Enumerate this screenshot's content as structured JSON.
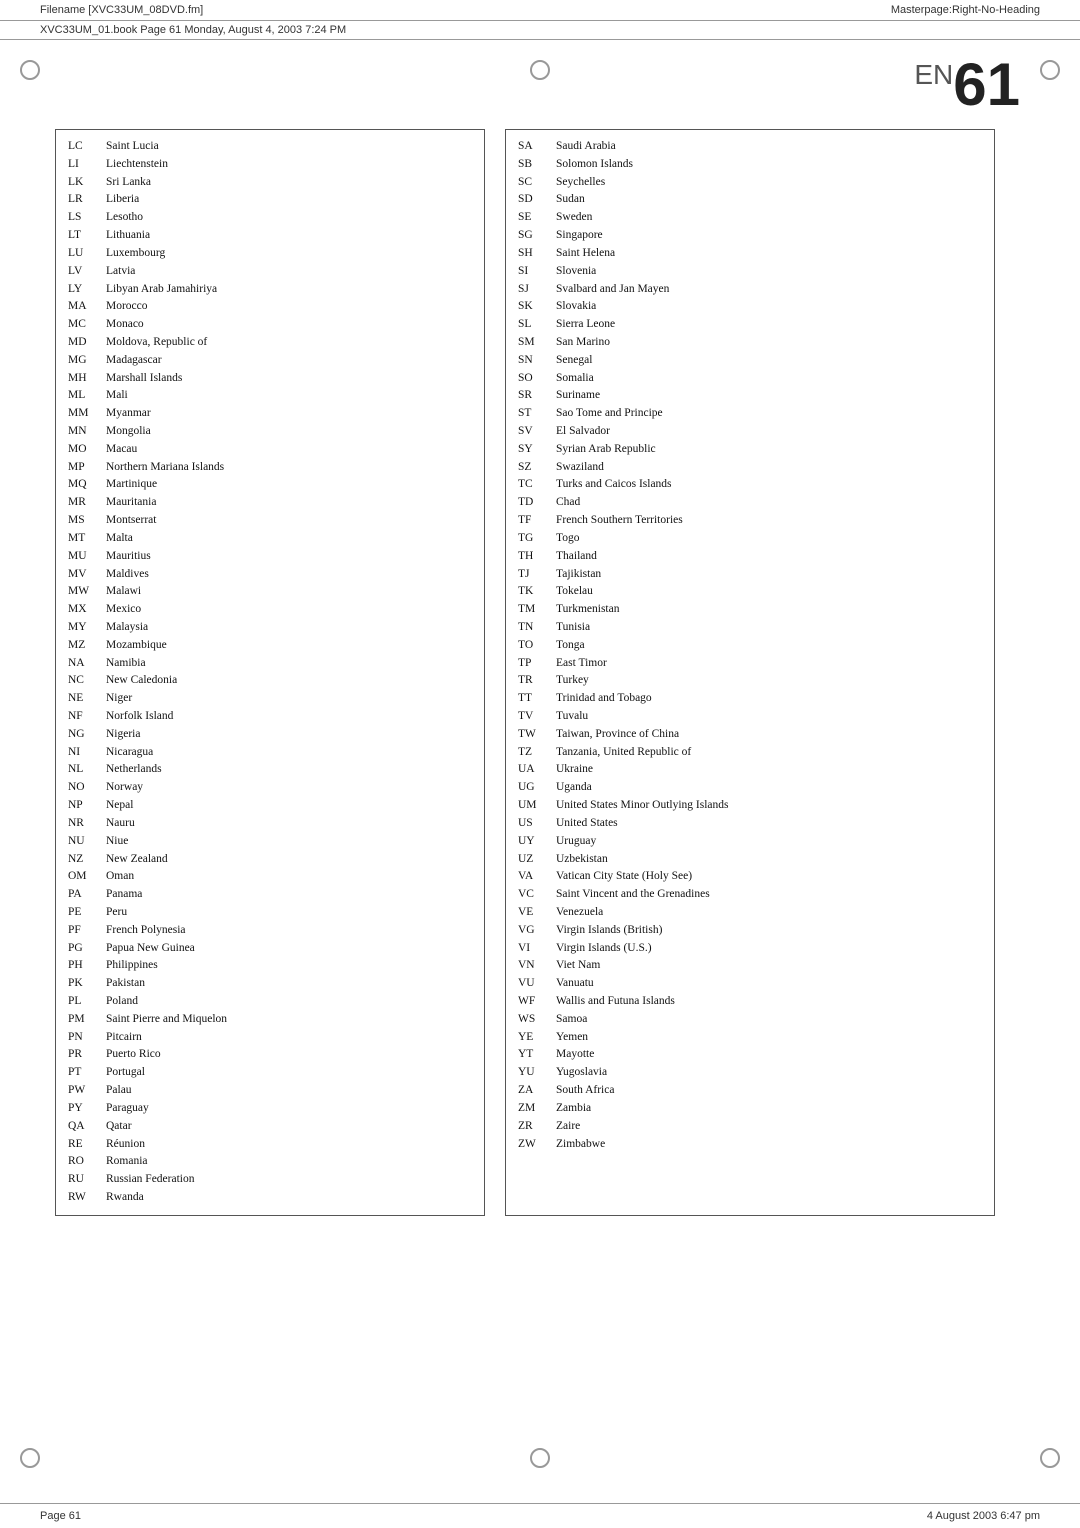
{
  "header": {
    "filename": "Filename [XVC33UM_08DVD.fm]",
    "bookref": "XVC33UM_01.book  Page 61  Monday, August 4, 2003  7:24 PM",
    "masterpage": "Masterpage:Right-No-Heading"
  },
  "page_number_prefix": "EN",
  "page_number": "61",
  "footer": {
    "left": "Page 61",
    "right": "4 August 2003  6:47 pm"
  },
  "left_countries": [
    {
      "code": "LC",
      "name": "Saint Lucia"
    },
    {
      "code": "LI",
      "name": "Liechtenstein"
    },
    {
      "code": "LK",
      "name": "Sri Lanka"
    },
    {
      "code": "LR",
      "name": "Liberia"
    },
    {
      "code": "LS",
      "name": "Lesotho"
    },
    {
      "code": "LT",
      "name": "Lithuania"
    },
    {
      "code": "LU",
      "name": "Luxembourg"
    },
    {
      "code": "LV",
      "name": "Latvia"
    },
    {
      "code": "LY",
      "name": "Libyan Arab Jamahiriya"
    },
    {
      "code": "MA",
      "name": "Morocco"
    },
    {
      "code": "MC",
      "name": "Monaco"
    },
    {
      "code": "MD",
      "name": "Moldova, Republic of"
    },
    {
      "code": "MG",
      "name": "Madagascar"
    },
    {
      "code": "MH",
      "name": "Marshall Islands"
    },
    {
      "code": "ML",
      "name": "Mali"
    },
    {
      "code": "MM",
      "name": "Myanmar"
    },
    {
      "code": "MN",
      "name": "Mongolia"
    },
    {
      "code": "MO",
      "name": "Macau"
    },
    {
      "code": "MP",
      "name": "Northern Mariana Islands"
    },
    {
      "code": "MQ",
      "name": "Martinique"
    },
    {
      "code": "MR",
      "name": "Mauritania"
    },
    {
      "code": "MS",
      "name": "Montserrat"
    },
    {
      "code": "MT",
      "name": "Malta"
    },
    {
      "code": "MU",
      "name": "Mauritius"
    },
    {
      "code": "MV",
      "name": "Maldives"
    },
    {
      "code": "MW",
      "name": "Malawi"
    },
    {
      "code": "MX",
      "name": "Mexico"
    },
    {
      "code": "MY",
      "name": "Malaysia"
    },
    {
      "code": "MZ",
      "name": "Mozambique"
    },
    {
      "code": "NA",
      "name": "Namibia"
    },
    {
      "code": "NC",
      "name": "New Caledonia"
    },
    {
      "code": "NE",
      "name": "Niger"
    },
    {
      "code": "NF",
      "name": "Norfolk Island"
    },
    {
      "code": "NG",
      "name": "Nigeria"
    },
    {
      "code": "NI",
      "name": "Nicaragua"
    },
    {
      "code": "NL",
      "name": "Netherlands"
    },
    {
      "code": "NO",
      "name": "Norway"
    },
    {
      "code": "NP",
      "name": "Nepal"
    },
    {
      "code": "NR",
      "name": "Nauru"
    },
    {
      "code": "NU",
      "name": "Niue"
    },
    {
      "code": "NZ",
      "name": "New Zealand"
    },
    {
      "code": "OM",
      "name": "Oman"
    },
    {
      "code": "PA",
      "name": "Panama"
    },
    {
      "code": "PE",
      "name": "Peru"
    },
    {
      "code": "PF",
      "name": "French Polynesia"
    },
    {
      "code": "PG",
      "name": "Papua New Guinea"
    },
    {
      "code": "PH",
      "name": "Philippines"
    },
    {
      "code": "PK",
      "name": "Pakistan"
    },
    {
      "code": "PL",
      "name": "Poland"
    },
    {
      "code": "PM",
      "name": "Saint Pierre and Miquelon"
    },
    {
      "code": "PN",
      "name": "Pitcairn"
    },
    {
      "code": "PR",
      "name": "Puerto Rico"
    },
    {
      "code": "PT",
      "name": "Portugal"
    },
    {
      "code": "PW",
      "name": "Palau"
    },
    {
      "code": "PY",
      "name": "Paraguay"
    },
    {
      "code": "QA",
      "name": "Qatar"
    },
    {
      "code": "RE",
      "name": "Réunion"
    },
    {
      "code": "RO",
      "name": "Romania"
    },
    {
      "code": "RU",
      "name": "Russian Federation"
    },
    {
      "code": "RW",
      "name": "Rwanda"
    }
  ],
  "right_countries": [
    {
      "code": "SA",
      "name": "Saudi Arabia"
    },
    {
      "code": "SB",
      "name": "Solomon Islands"
    },
    {
      "code": "SC",
      "name": "Seychelles"
    },
    {
      "code": "SD",
      "name": "Sudan"
    },
    {
      "code": "SE",
      "name": "Sweden"
    },
    {
      "code": "SG",
      "name": "Singapore"
    },
    {
      "code": "SH",
      "name": "Saint Helena"
    },
    {
      "code": "SI",
      "name": "Slovenia"
    },
    {
      "code": "SJ",
      "name": "Svalbard and Jan Mayen"
    },
    {
      "code": "SK",
      "name": "Slovakia"
    },
    {
      "code": "SL",
      "name": "Sierra Leone"
    },
    {
      "code": "SM",
      "name": "San Marino"
    },
    {
      "code": "SN",
      "name": "Senegal"
    },
    {
      "code": "SO",
      "name": "Somalia"
    },
    {
      "code": "SR",
      "name": "Suriname"
    },
    {
      "code": "ST",
      "name": "Sao Tome and Principe"
    },
    {
      "code": "SV",
      "name": "El Salvador"
    },
    {
      "code": "SY",
      "name": "Syrian Arab Republic"
    },
    {
      "code": "SZ",
      "name": "Swaziland"
    },
    {
      "code": "TC",
      "name": "Turks and Caicos Islands"
    },
    {
      "code": "TD",
      "name": "Chad"
    },
    {
      "code": "TF",
      "name": "French Southern Territories"
    },
    {
      "code": "TG",
      "name": "Togo"
    },
    {
      "code": "TH",
      "name": "Thailand"
    },
    {
      "code": "TJ",
      "name": "Tajikistan"
    },
    {
      "code": "TK",
      "name": "Tokelau"
    },
    {
      "code": "TM",
      "name": "Turkmenistan"
    },
    {
      "code": "TN",
      "name": "Tunisia"
    },
    {
      "code": "TO",
      "name": "Tonga"
    },
    {
      "code": "TP",
      "name": "East Timor"
    },
    {
      "code": "TR",
      "name": "Turkey"
    },
    {
      "code": "TT",
      "name": "Trinidad and Tobago"
    },
    {
      "code": "TV",
      "name": "Tuvalu"
    },
    {
      "code": "TW",
      "name": "Taiwan, Province of China"
    },
    {
      "code": "TZ",
      "name": "Tanzania, United Republic of"
    },
    {
      "code": "UA",
      "name": "Ukraine"
    },
    {
      "code": "UG",
      "name": "Uganda"
    },
    {
      "code": "UM",
      "name": "United States Minor Outlying Islands"
    },
    {
      "code": "US",
      "name": "United States"
    },
    {
      "code": "UY",
      "name": "Uruguay"
    },
    {
      "code": "UZ",
      "name": "Uzbekistan"
    },
    {
      "code": "VA",
      "name": "Vatican City State (Holy See)"
    },
    {
      "code": "VC",
      "name": "Saint Vincent and the Grenadines"
    },
    {
      "code": "VE",
      "name": "Venezuela"
    },
    {
      "code": "VG",
      "name": "Virgin Islands (British)"
    },
    {
      "code": "VI",
      "name": "Virgin Islands (U.S.)"
    },
    {
      "code": "VN",
      "name": "Viet Nam"
    },
    {
      "code": "VU",
      "name": "Vanuatu"
    },
    {
      "code": "WF",
      "name": "Wallis and Futuna Islands"
    },
    {
      "code": "WS",
      "name": "Samoa"
    },
    {
      "code": "YE",
      "name": "Yemen"
    },
    {
      "code": "YT",
      "name": "Mayotte"
    },
    {
      "code": "YU",
      "name": "Yugoslavia"
    },
    {
      "code": "ZA",
      "name": "South Africa"
    },
    {
      "code": "ZM",
      "name": "Zambia"
    },
    {
      "code": "ZR",
      "name": "Zaire"
    },
    {
      "code": "ZW",
      "name": "Zimbabwe"
    }
  ]
}
